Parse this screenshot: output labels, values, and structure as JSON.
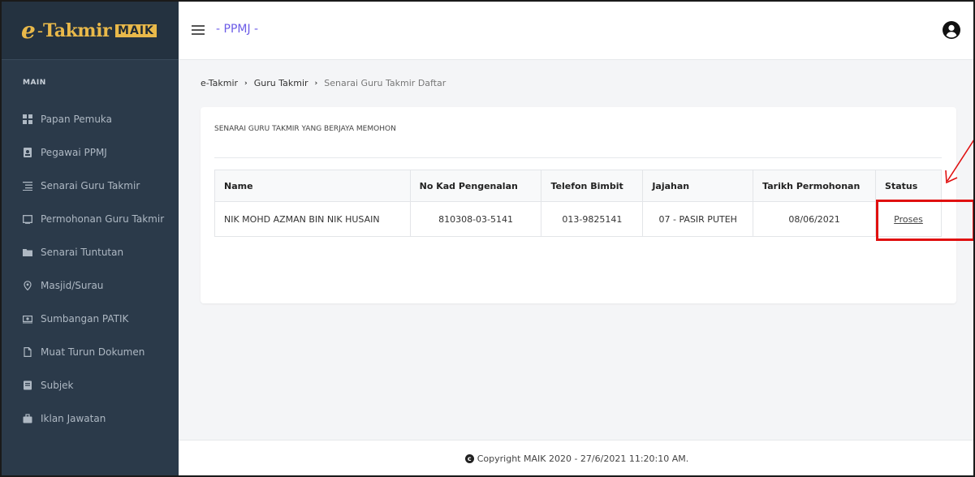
{
  "logo": {
    "e": "e",
    "dash": "-",
    "takmir": "Takmir",
    "maik": "MAIK"
  },
  "header": {
    "brand": "- PPMJ -"
  },
  "sidebar": {
    "section": "MAIN",
    "items": [
      {
        "label": "Papan Pemuka",
        "icon": "dashboard-icon"
      },
      {
        "label": "Pegawai PPMJ",
        "icon": "id-badge-icon"
      },
      {
        "label": "Senarai Guru Takmir",
        "icon": "list-icon"
      },
      {
        "label": "Permohonan Guru Takmir",
        "icon": "window-icon"
      },
      {
        "label": "Senarai Tuntutan",
        "icon": "folder-icon"
      },
      {
        "label": "Masjid/Surau",
        "icon": "map-pin-icon"
      },
      {
        "label": "Sumbangan PATIK",
        "icon": "money-icon"
      },
      {
        "label": "Muat Turun Dokumen",
        "icon": "file-icon"
      },
      {
        "label": "Subjek",
        "icon": "book-icon"
      },
      {
        "label": "Iklan Jawatan",
        "icon": "briefcase-icon"
      }
    ]
  },
  "breadcrumb": {
    "items": [
      "e-Takmir",
      "Guru Takmir",
      "Senarai Guru Takmir Daftar"
    ]
  },
  "card": {
    "title": "SENARAI GURU TAKMIR YANG BERJAYA MEMOHON",
    "table": {
      "headers": [
        "Name",
        "No Kad Pengenalan",
        "Telefon Bimbit",
        "Jajahan",
        "Tarikh Permohonan",
        "Status"
      ],
      "rows": [
        [
          "NIK MOHD AZMAN BIN NIK HUSAIN",
          "810308-03-5141",
          "013-9825141",
          "07 - PASIR PUTEH",
          "08/06/2021",
          "Proses"
        ]
      ]
    }
  },
  "footer": {
    "text": "Copyright MAIK 2020 - 27/6/2021 11:20:10 AM."
  },
  "colors": {
    "sidebar": "#2b3a4a",
    "brand": "#6c5ce7",
    "logo": "#e9b94a",
    "annotation": "#e01010"
  }
}
